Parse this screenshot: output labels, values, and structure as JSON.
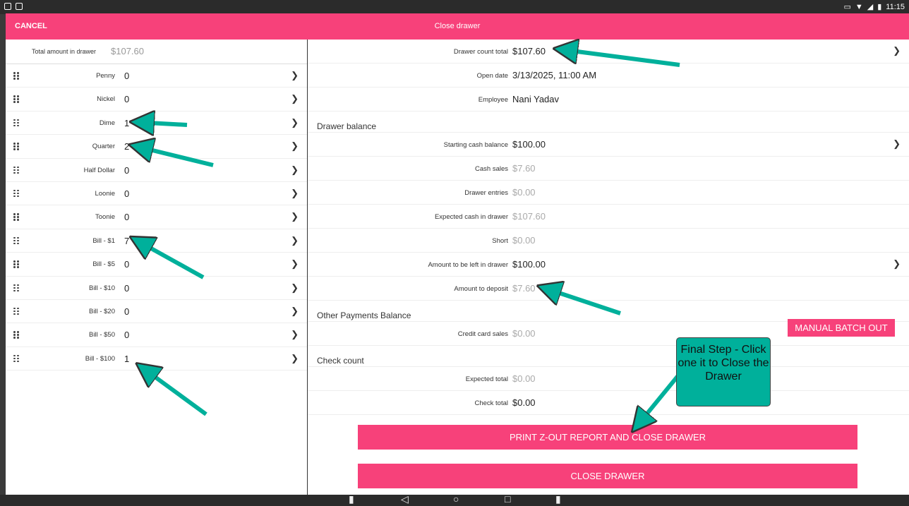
{
  "status_bar": {
    "time": "11:15"
  },
  "header": {
    "cancel_label": "CANCEL",
    "title": "Close drawer"
  },
  "drawer_total": {
    "label": "Total amount in drawer",
    "value": "$107.60"
  },
  "denominations": [
    {
      "label": "Penny",
      "value": "0"
    },
    {
      "label": "Nickel",
      "value": "0"
    },
    {
      "label": "Dime",
      "value": "1"
    },
    {
      "label": "Quarter",
      "value": "2"
    },
    {
      "label": "Half Dollar",
      "value": "0"
    },
    {
      "label": "Loonie",
      "value": "0"
    },
    {
      "label": "Toonie",
      "value": "0"
    },
    {
      "label": "Bill - $1",
      "value": "7"
    },
    {
      "label": "Bill - $5",
      "value": "0"
    },
    {
      "label": "Bill - $10",
      "value": "0"
    },
    {
      "label": "Bill - $20",
      "value": "0"
    },
    {
      "label": "Bill - $50",
      "value": "0"
    },
    {
      "label": "Bill - $100",
      "value": "1"
    }
  ],
  "summary": {
    "drawer_count_total": {
      "label": "Drawer count total",
      "value": "$107.60"
    },
    "open_date": {
      "label": "Open date",
      "value": "3/13/2025, 11:00 AM"
    },
    "employee": {
      "label": "Employee",
      "value": "Nani Yadav"
    }
  },
  "drawer_balance": {
    "heading": "Drawer balance",
    "starting_cash": {
      "label": "Starting cash balance",
      "value": "$100.00"
    },
    "cash_sales": {
      "label": "Cash sales",
      "value": "$7.60"
    },
    "drawer_entries": {
      "label": "Drawer entries",
      "value": "$0.00"
    },
    "expected_cash": {
      "label": "Expected cash in drawer",
      "value": "$107.60"
    },
    "short": {
      "label": "Short",
      "value": "$0.00"
    },
    "left_in_drawer": {
      "label": "Amount to be left in drawer",
      "value": "$100.00"
    },
    "to_deposit": {
      "label": "Amount to deposit",
      "value": "$7.60"
    }
  },
  "other_payments": {
    "heading": "Other Payments Balance",
    "credit_card_sales": {
      "label": "Credit card sales",
      "value": "$0.00"
    },
    "manual_batch_label": "MANUAL BATCH OUT"
  },
  "check_count": {
    "heading": "Check count",
    "expected_total": {
      "label": "Expected total",
      "value": "$0.00"
    },
    "check_total": {
      "label": "Check total",
      "value": "$0.00"
    }
  },
  "actions": {
    "print_close_label": "PRINT Z-OUT REPORT AND CLOSE DRAWER",
    "close_label": "CLOSE DRAWER"
  },
  "callout": {
    "text": "Final Step - Click one it to Close the Drawer"
  },
  "colors": {
    "accent": "#f7417a",
    "annotation": "#00b09b"
  }
}
